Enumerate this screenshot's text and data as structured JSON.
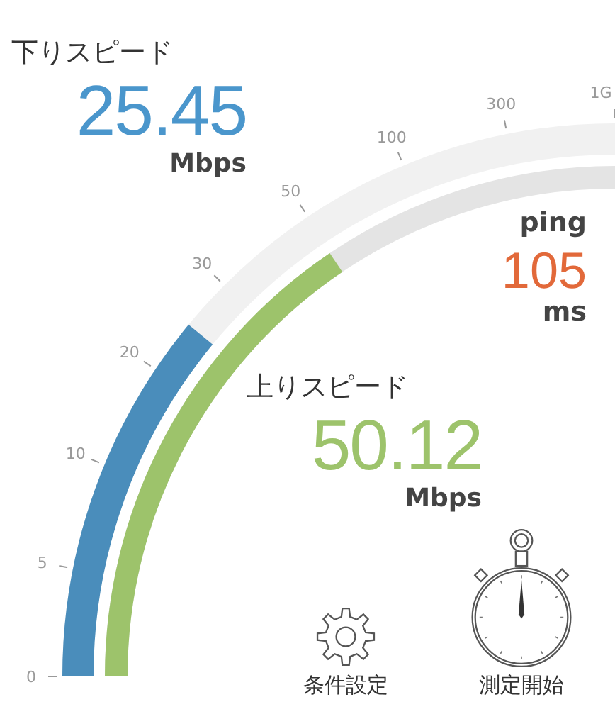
{
  "download": {
    "label": "下りスピード",
    "value": "25.45",
    "unit": "Mbps"
  },
  "ping": {
    "label": "ping",
    "value": "105",
    "unit": "ms"
  },
  "upload": {
    "label": "上りスピード",
    "value": "50.12",
    "unit": "Mbps"
  },
  "scale": {
    "ticks": [
      "0",
      "5",
      "10",
      "20",
      "30",
      "50",
      "100",
      "300",
      "1G"
    ]
  },
  "buttons": [
    {
      "kind": "settings",
      "label": "条件設定"
    },
    {
      "kind": "start",
      "label": "測定開始"
    }
  ]
}
